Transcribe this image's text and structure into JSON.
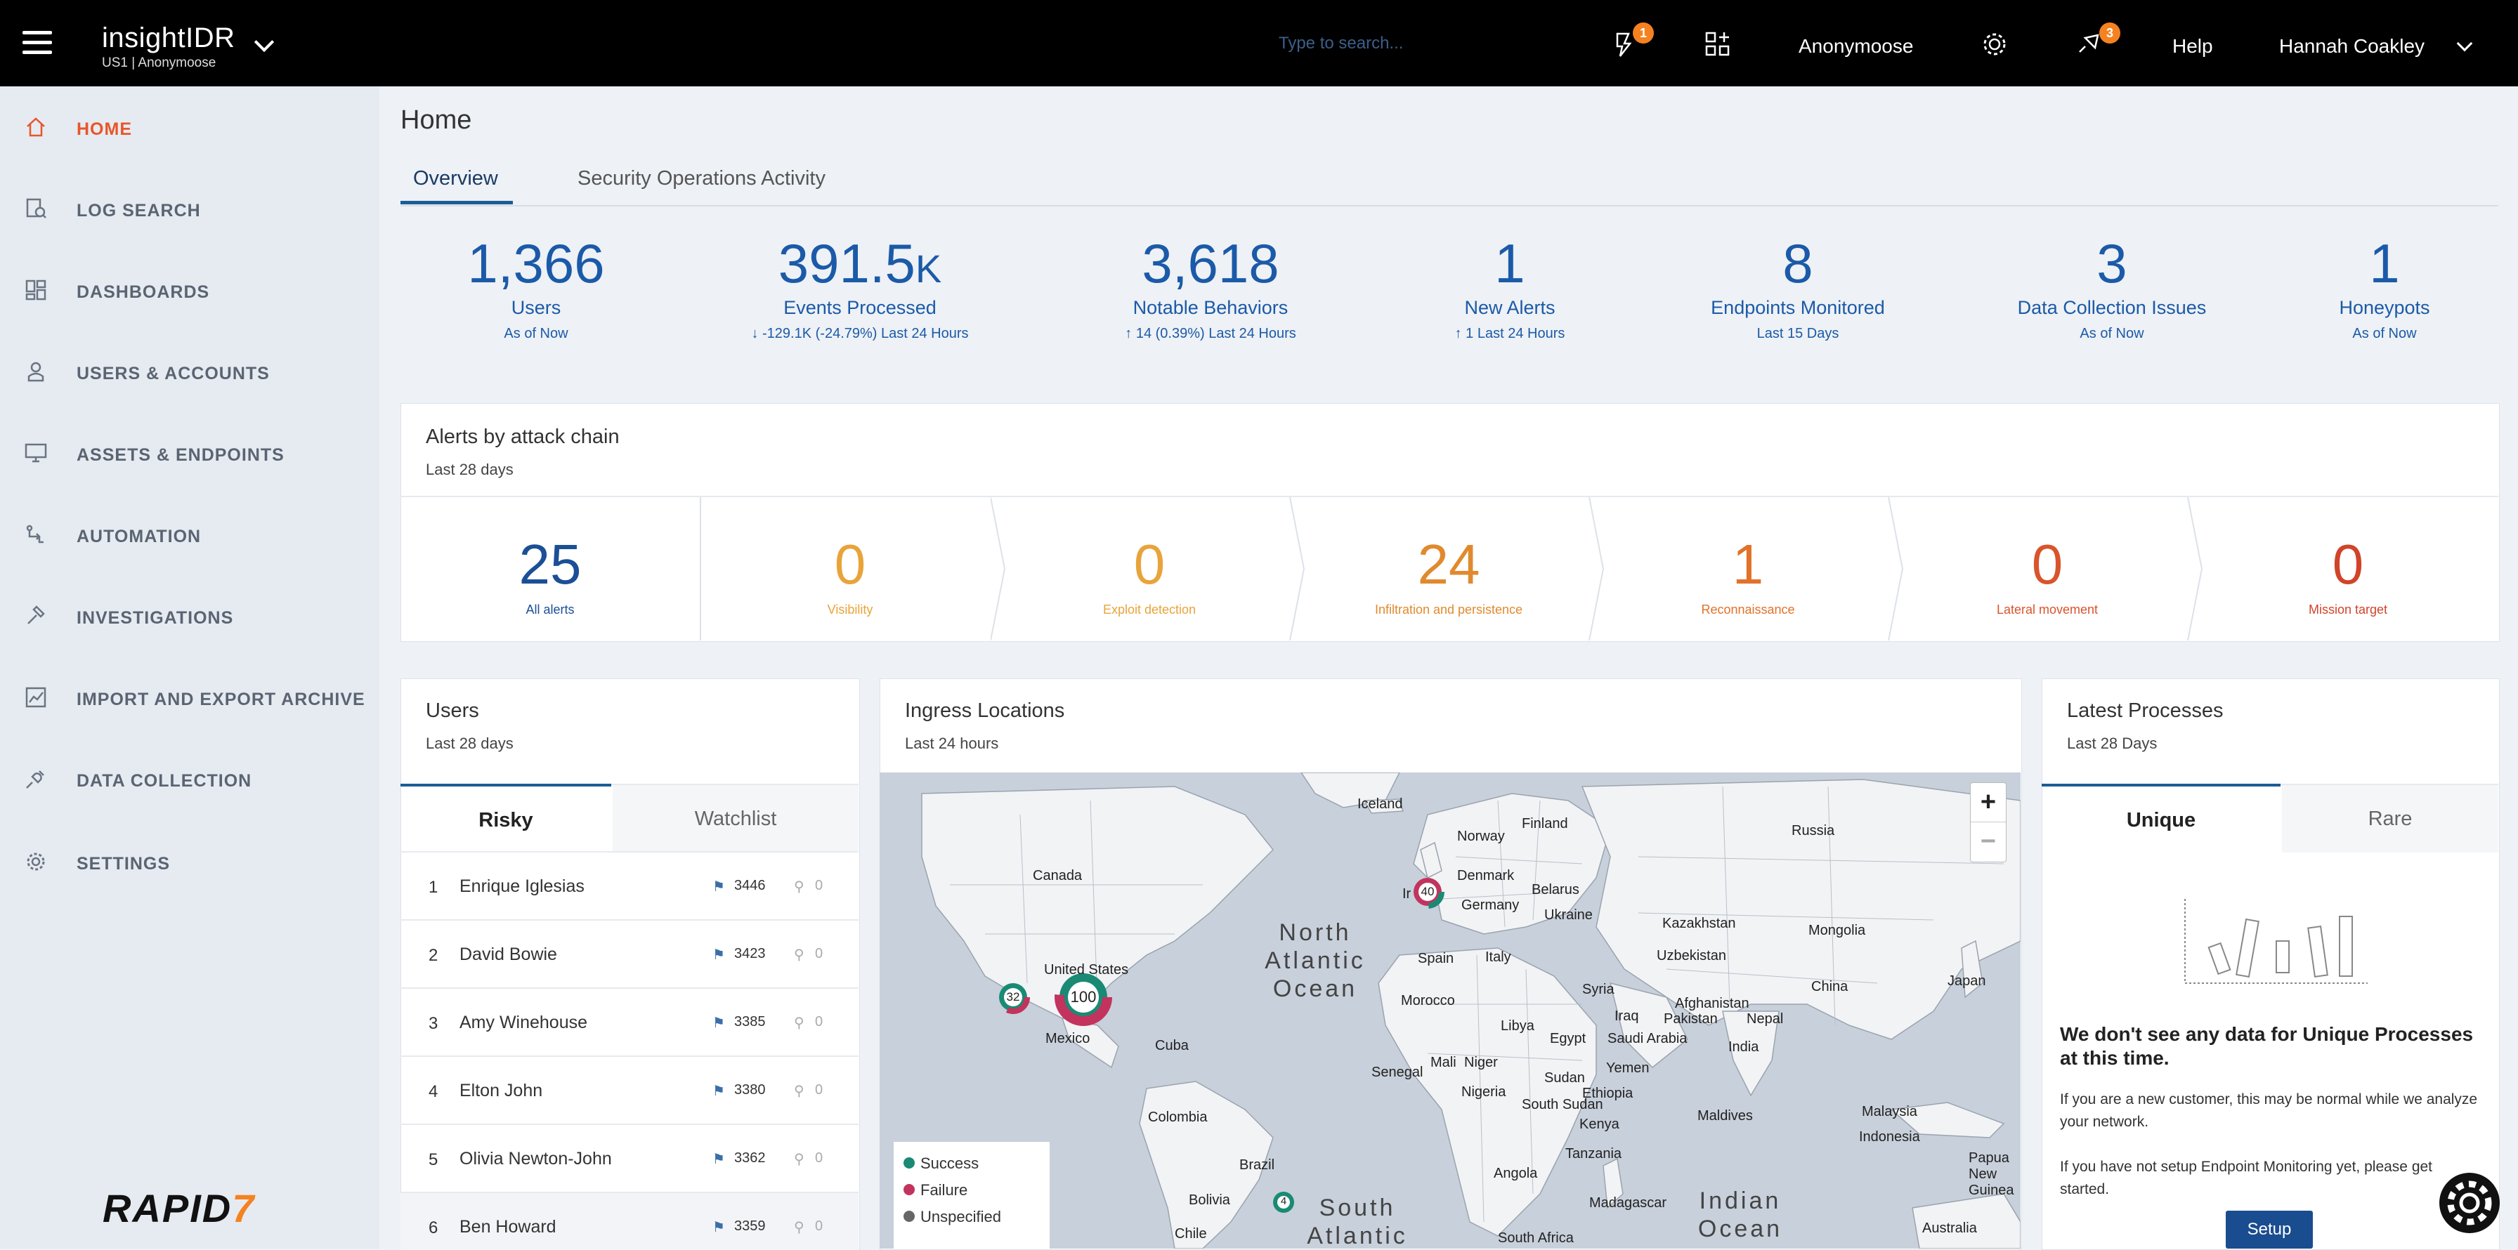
{
  "topbar": {
    "product": "insightIDR",
    "region_org": "US1 | Anonymoose",
    "search_placeholder": "Type to search...",
    "alerts_badge": "1",
    "org_name": "Anonymoose",
    "notifications_badge": "3",
    "help": "Help",
    "user_name": "Hannah Coakley",
    "icons": [
      "menu-icon",
      "chevron-down-icon",
      "alert-icon",
      "apps-icon",
      "gear-icon",
      "announcement-icon"
    ]
  },
  "sidebar": {
    "items": [
      {
        "label": "HOME",
        "icon": "home-icon",
        "active": true
      },
      {
        "label": "LOG SEARCH",
        "icon": "log-search-icon"
      },
      {
        "label": "DASHBOARDS",
        "icon": "dashboard-icon"
      },
      {
        "label": "USERS & ACCOUNTS",
        "icon": "user-icon"
      },
      {
        "label": "ASSETS & ENDPOINTS",
        "icon": "monitor-icon"
      },
      {
        "label": "AUTOMATION",
        "icon": "automation-icon"
      },
      {
        "label": "INVESTIGATIONS",
        "icon": "hammer-icon"
      },
      {
        "label": "IMPORT AND EXPORT ARCHIVE",
        "icon": "chart-icon"
      },
      {
        "label": "DATA COLLECTION",
        "icon": "plug-icon"
      },
      {
        "label": "SETTINGS",
        "icon": "gear-icon"
      }
    ],
    "logo": "RAPID",
    "logo_mark": "7"
  },
  "main": {
    "title": "Home",
    "tabs": [
      {
        "label": "Overview",
        "active": true
      },
      {
        "label": "Security Operations Activity"
      }
    ],
    "stats": [
      {
        "value": "1,366",
        "label": "Users",
        "sub": "As of Now"
      },
      {
        "value": "391.5",
        "unit": "K",
        "label": "Events Processed",
        "sub": "↓ -129.1K (-24.79%)   Last 24 Hours"
      },
      {
        "value": "3,618",
        "label": "Notable Behaviors",
        "sub": "↑ 14 (0.39%)   Last 24 Hours"
      },
      {
        "value": "1",
        "label": "New Alerts",
        "sub": "↑ 1   Last 24 Hours"
      },
      {
        "value": "8",
        "label": "Endpoints Monitored",
        "sub": "Last 15 Days"
      },
      {
        "value": "3",
        "label": "Data Collection Issues",
        "sub": "As of Now"
      },
      {
        "value": "1",
        "label": "Honeypots",
        "sub": "As of Now"
      }
    ]
  },
  "alerts_chain": {
    "title": "Alerts by attack chain",
    "subtitle": "Last 28 days",
    "stages": [
      {
        "value": "25",
        "label": "All alerts",
        "color": "#1b4f96"
      },
      {
        "value": "0",
        "label": "Visibility",
        "color": "#e8a43a"
      },
      {
        "value": "0",
        "label": "Exploit detection",
        "color": "#e8a43a"
      },
      {
        "value": "24",
        "label": "Infiltration and persistence",
        "color": "#e08a2e"
      },
      {
        "value": "1",
        "label": "Reconnaissance",
        "color": "#e0722a"
      },
      {
        "value": "0",
        "label": "Lateral movement",
        "color": "#d9542c"
      },
      {
        "value": "0",
        "label": "Mission target",
        "color": "#d0442a"
      }
    ]
  },
  "users_card": {
    "title": "Users",
    "subtitle": "Last 28 days",
    "tabs": [
      {
        "label": "Risky",
        "active": true
      },
      {
        "label": "Watchlist"
      }
    ],
    "rows": [
      {
        "rank": "1",
        "name": "Enrique Iglesias",
        "score": "3446",
        "pins": "0"
      },
      {
        "rank": "2",
        "name": "David Bowie",
        "score": "3423",
        "pins": "0"
      },
      {
        "rank": "3",
        "name": "Amy Winehouse",
        "score": "3385",
        "pins": "0"
      },
      {
        "rank": "4",
        "name": "Elton John",
        "score": "3380",
        "pins": "0"
      },
      {
        "rank": "5",
        "name": "Olivia Newton-John",
        "score": "3362",
        "pins": "0"
      },
      {
        "rank": "6",
        "name": "Ben Howard",
        "score": "3359",
        "pins": "0"
      }
    ]
  },
  "ingress": {
    "title": "Ingress Locations",
    "subtitle": "Last 24 hours",
    "zoom_in": "+",
    "zoom_out": "−",
    "clusters": [
      {
        "count": "40",
        "place": "Ireland"
      },
      {
        "count": "32",
        "place": "United States West"
      },
      {
        "count": "100",
        "place": "United States"
      },
      {
        "count": "4",
        "place": "Brazil"
      }
    ],
    "labels": [
      "Iceland",
      "Finland",
      "Norway",
      "Russia",
      "Canada",
      "Denmark",
      "Belarus",
      "Germany",
      "Ukraine",
      "Kazakhstan",
      "Mongolia",
      "United States",
      "Spain",
      "Italy",
      "Uzbekistan",
      "Japan",
      "Mexico",
      "Morocco",
      "Syria",
      "China",
      "Afghanistan",
      "Pakistan",
      "Nepal",
      "Iraq",
      "Libya",
      "Egypt",
      "Saudi Arabia",
      "India",
      "Cuba",
      "Senegal",
      "Mali",
      "Niger",
      "Sudan",
      "Yemen",
      "Nigeria",
      "Ethiopia",
      "South Sudan",
      "Maldives",
      "Malaysia",
      "Colombia",
      "Kenya",
      "Tanzania",
      "Indonesia",
      "Brazil",
      "Angola",
      "Papua New Guinea",
      "Bolivia",
      "Madagascar",
      "Chile",
      "South Africa",
      "Australia",
      "Ir"
    ],
    "oceans": [
      "North Atlantic Ocean",
      "South Atlantic",
      "Indian Ocean"
    ],
    "legend": [
      {
        "label": "Success",
        "color": "#1a8a74"
      },
      {
        "label": "Failure",
        "color": "#c2335d"
      },
      {
        "label": "Unspecified",
        "color": "#666666"
      }
    ]
  },
  "processes": {
    "title": "Latest Processes",
    "subtitle": "Last 28 Days",
    "tabs": [
      {
        "label": "Unique",
        "active": true
      },
      {
        "label": "Rare"
      }
    ],
    "empty_title": "We don't see any data for Unique Processes at this time.",
    "empty_p1": "If you are a new customer, this may be normal while we analyze your network.",
    "empty_p2": "If you have not setup Endpoint Monitoring yet, please get started.",
    "setup_label": "Setup"
  }
}
